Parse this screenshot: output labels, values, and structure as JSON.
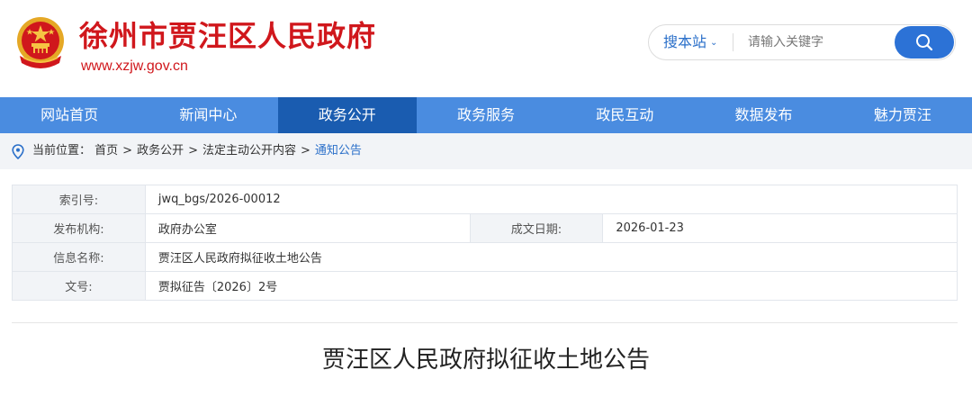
{
  "header": {
    "title": "徐州市贾汪区人民政府",
    "url": "www.xzjw.gov.cn",
    "emblem_icon": "national-emblem-icon",
    "accent_color": "#d0171c"
  },
  "search": {
    "scope": "搜本站",
    "placeholder": "请输入关键字",
    "button_icon": "search-icon",
    "button_color": "#2c72d6"
  },
  "nav": {
    "items": [
      {
        "label": "网站首页"
      },
      {
        "label": "新闻中心"
      },
      {
        "label": "政务公开",
        "active": true
      },
      {
        "label": "政务服务"
      },
      {
        "label": "政民互动"
      },
      {
        "label": "数据发布"
      },
      {
        "label": "魅力贾汪"
      }
    ],
    "bg_color": "#4a8ce0",
    "active_color": "#1a5cb0"
  },
  "breadcrumb": {
    "prefix": "当前位置：",
    "items": [
      "首页",
      "政务公开",
      "法定主动公开内容",
      "通知公告"
    ]
  },
  "info": {
    "index_label": "索引号:",
    "index_value": "jwq_bgs/2026-00012",
    "org_label": "发布机构:",
    "org_value": "政府办公室",
    "date_label": "成文日期:",
    "date_value": "2026-01-23",
    "name_label": "信息名称:",
    "name_value": "贾汪区人民政府拟征收土地公告",
    "docno_label": "文号:",
    "docno_value": "贾拟征告〔2026〕2号"
  },
  "article": {
    "title": "贾汪区人民政府拟征收土地公告"
  }
}
